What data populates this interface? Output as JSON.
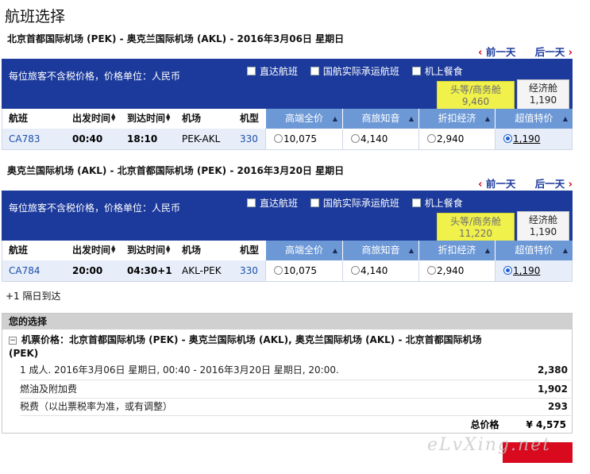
{
  "page_title": "航班选择",
  "nav": {
    "prev_day": "前一天",
    "next_day": "后一天"
  },
  "bar": {
    "note": "每位旅客不含税价格，价格单位：人民币",
    "filters": [
      "直达航班",
      "国航实际承运航班",
      "机上餐食"
    ]
  },
  "columns": {
    "flight": "航班",
    "departure": "出发时间",
    "arrival": "到达时间",
    "airport": "机场",
    "aircraft": "机型",
    "fares": [
      "高端全价",
      "商旅知音",
      "折扣经济",
      "超值特价"
    ]
  },
  "outbound": {
    "route": "北京首都国际机场 (PEK) - 奥克兰国际机场 (AKL) - 2016年3月06日 星期日",
    "cabins": {
      "first_label": "头等/商务舱",
      "first_price": "9,460",
      "eco_label": "经济舱",
      "eco_price": "1,190"
    },
    "row": {
      "flight": "CA783",
      "dep": "00:40",
      "arr": "18:10",
      "airport": "PEK-AKL",
      "aircraft": "330",
      "fares": [
        "10,075",
        "4,140",
        "2,940",
        "1,190"
      ],
      "selected_index": 3
    }
  },
  "return": {
    "route": "奥克兰国际机场 (AKL) - 北京首都国际机场 (PEK) - 2016年3月20日 星期日",
    "cabins": {
      "first_label": "头等/商务舱",
      "first_price": "11,220",
      "eco_label": "经济舱",
      "eco_price": "1,190"
    },
    "row": {
      "flight": "CA784",
      "dep": "20:00",
      "arr": "04:30+1",
      "airport": "AKL-PEK",
      "aircraft": "330",
      "fares": [
        "10,075",
        "4,140",
        "2,940",
        "1,190"
      ],
      "selected_index": 3
    }
  },
  "next_day_note": "+1 隔日到达",
  "summary": {
    "header": "您的选择",
    "title": "机票价格：北京首都国际机场 (PEK) - 奥克兰国际机场 (AKL), 奥克兰国际机场 (AKL) - 北京首都国际机场 (PEK)",
    "lines": [
      {
        "label": "1 成人. 2016年3月06日 星期日, 00:40 - 2016年3月20日 星期日, 20:00.",
        "amount": "2,380"
      },
      {
        "label": "燃油及附加费",
        "amount": "1,902"
      },
      {
        "label": "税费（以出票税率为准，或有调整）",
        "amount": "293"
      }
    ],
    "total_label": "总价格",
    "total_value": "¥ 4,575"
  },
  "watermark": "eLvXing.net",
  "colors": {
    "bar": "#1c3a9c",
    "fare_header": "#6c98d6",
    "row_bg": "#e7eef9",
    "first_cabin": "#f0f14b",
    "arrow": "#d6001c",
    "button": "#d90a1e"
  }
}
